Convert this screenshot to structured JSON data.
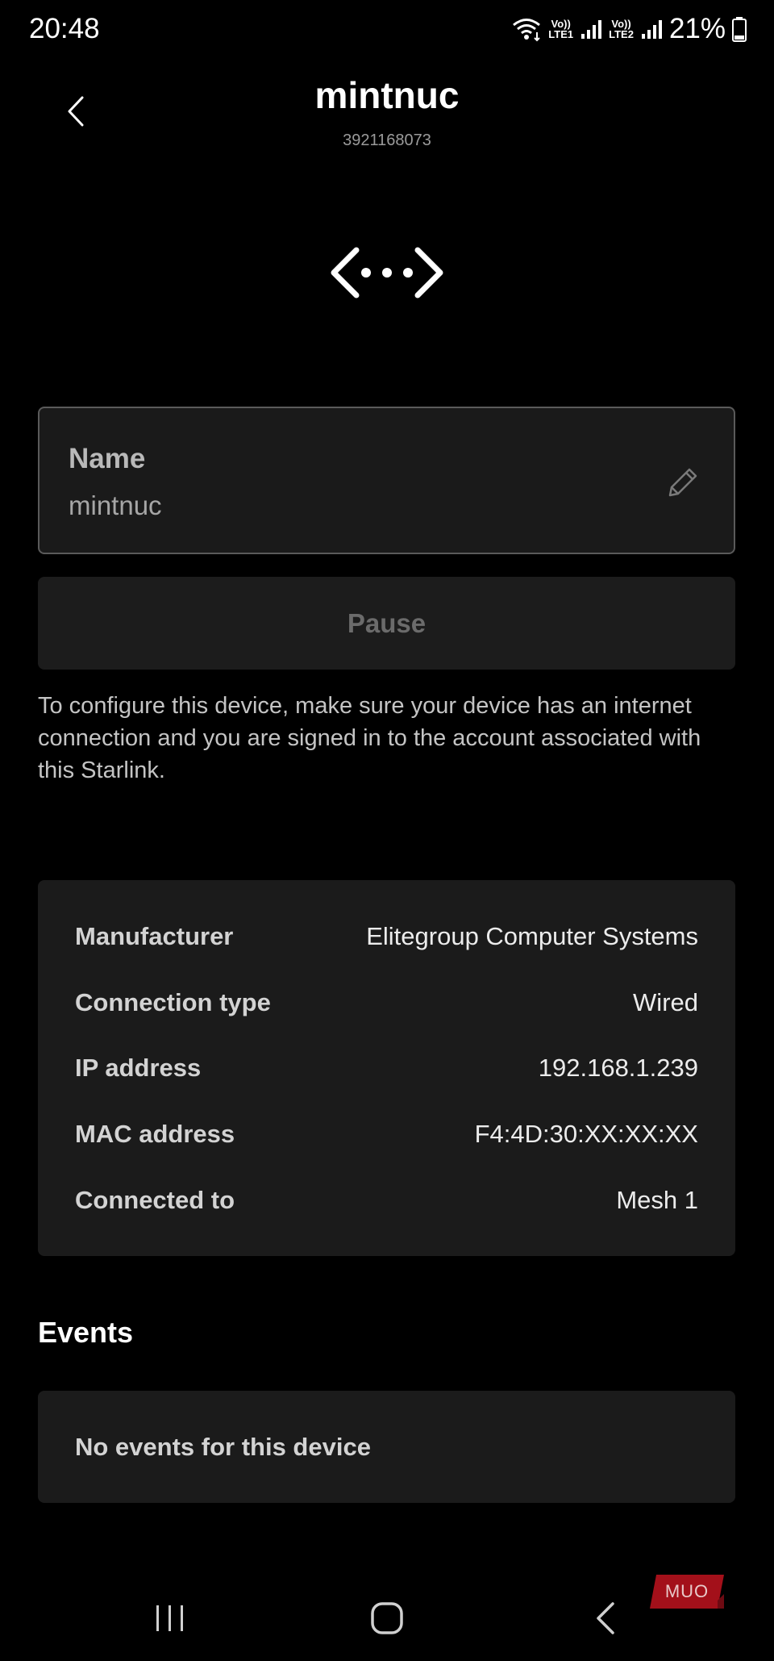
{
  "status_bar": {
    "time": "20:48",
    "network_1": [
      "Vo))",
      "LTE1"
    ],
    "network_2": [
      "Vo))",
      "LTE2"
    ],
    "battery_percent": "21%",
    "icons": [
      "wifi-icon",
      "signal-icon",
      "battery-icon"
    ]
  },
  "header": {
    "title": "mintnuc",
    "device_id": "3921168073",
    "back_icon": "chevron-left-icon",
    "device_icon": "ethernet-code-icon"
  },
  "name_field": {
    "label": "Name",
    "value": "mintnuc",
    "edit_icon": "pencil-icon"
  },
  "pause_button": {
    "label": "Pause"
  },
  "config_note": "To configure this device, make sure your device has an internet connection and you are signed in to the account associated with this Starlink.",
  "details": [
    {
      "key": "Manufacturer",
      "value": "Elitegroup Computer Systems"
    },
    {
      "key": "Connection type",
      "value": "Wired"
    },
    {
      "key": "IP address",
      "value": "192.168.1.239"
    },
    {
      "key": "MAC address",
      "value": "F4:4D:30:XX:XX:XX"
    },
    {
      "key": "Connected to",
      "value": "Mesh 1"
    }
  ],
  "events": {
    "heading": "Events",
    "empty_text": "No events for this device"
  },
  "nav_bar": {
    "icons": [
      "recent-apps-icon",
      "home-icon",
      "back-icon"
    ]
  },
  "watermark": {
    "text": "MUO",
    "color": "#a3101a"
  },
  "colors": {
    "background": "#000000",
    "card": "#1b1b1b",
    "field_border": "#5a5a5a"
  }
}
